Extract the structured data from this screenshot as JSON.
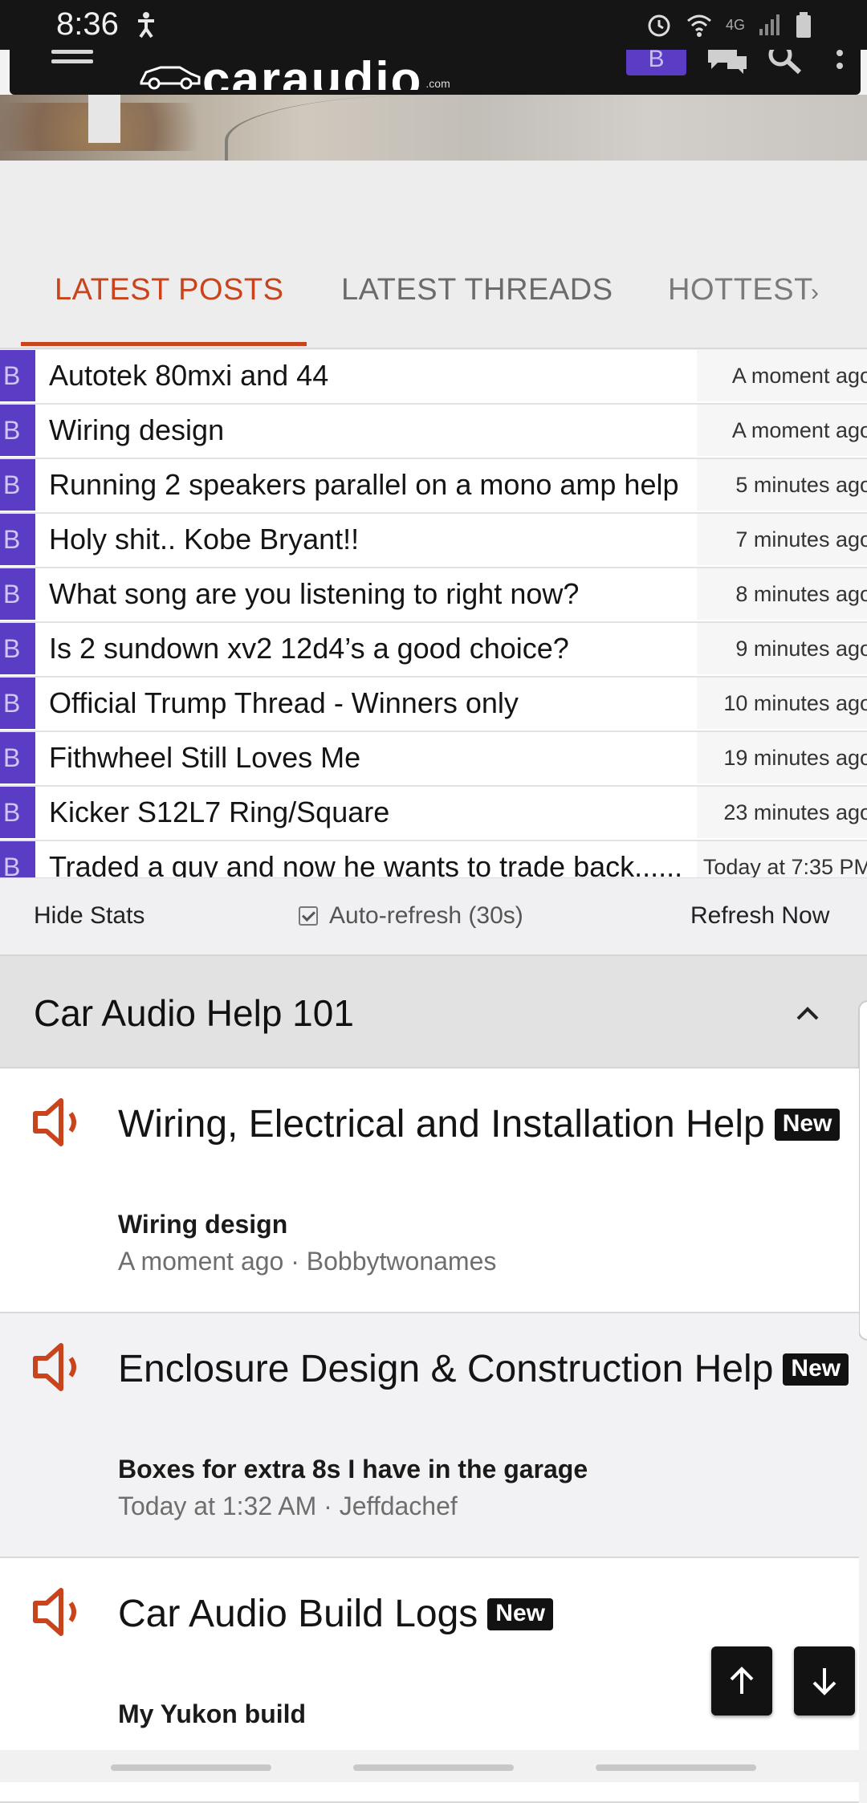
{
  "status_bar": {
    "time": "8:36",
    "network": "4G"
  },
  "header": {
    "logo_text": "caraudio",
    "logo_suffix": ".com",
    "avatar_letter": "B"
  },
  "tabs": [
    {
      "label": "LATEST POSTS",
      "active": true
    },
    {
      "label": "LATEST THREADS",
      "active": false
    },
    {
      "label": "HOTTEST",
      "active": false
    }
  ],
  "tab_arrow": "›",
  "posts": [
    {
      "badge": "B",
      "title": "Autotek 80mxi and 44",
      "time": "A moment ago"
    },
    {
      "badge": "B",
      "title": "Wiring design",
      "time": "A moment ago"
    },
    {
      "badge": "B",
      "title": "Running 2 speakers parallel on a mono amp help",
      "time": "5 minutes ago"
    },
    {
      "badge": "B",
      "title": "Holy shit.. Kobe Bryant!!",
      "time": "7 minutes ago"
    },
    {
      "badge": "B",
      "title": "What song are you listening to right now?",
      "time": "8 minutes ago"
    },
    {
      "badge": "B",
      "title": "Is 2 sundown xv2 12d4’s a good choice?",
      "time": "9 minutes ago"
    },
    {
      "badge": "B",
      "title": "Official Trump Thread - Winners only",
      "time": "10 minutes ago"
    },
    {
      "badge": "B",
      "title": "Fithwheel Still Loves Me",
      "time": "19 minutes ago"
    },
    {
      "badge": "B",
      "title": "Kicker S12L7 Ring/Square",
      "time": "23 minutes ago"
    },
    {
      "badge": "B",
      "title": "Traded a guy and now he wants to trade back......",
      "time": "Today at 7:35 PM"
    }
  ],
  "stats": {
    "hide_label": "Hide Stats",
    "autorefresh_label": "Auto-refresh (30s)",
    "autorefresh_checked": true,
    "refresh_label": "Refresh Now"
  },
  "category": {
    "title": "Car Audio Help 101",
    "collapsed": false
  },
  "forums": [
    {
      "title": "Wiring, Electrical and Installation Help",
      "badge": "New",
      "latest_thread": "Wiring design",
      "meta": "A moment ago · Bobbytwonames"
    },
    {
      "title": "Enclosure Design & Construction Help",
      "badge": "New",
      "latest_thread": "Boxes for extra 8s I have in the garage",
      "meta": "Today at 1:32 AM · Jeffdachef"
    },
    {
      "title": "Car Audio Build Logs",
      "badge": "New",
      "latest_thread": "My Yukon build",
      "meta": ""
    }
  ],
  "colors": {
    "accent": "#c9441c",
    "badge_purple": "#5b3cc4",
    "header_dark": "#151515"
  }
}
